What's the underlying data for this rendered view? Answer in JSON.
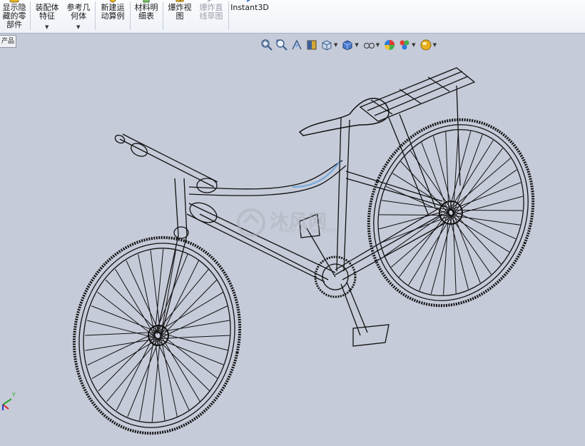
{
  "toolbar": {
    "show_hidden_label": "显示隐\n藏的零\n部件",
    "assembly_feature_label": "装配体\n特征",
    "reference_geometry_label": "参考几\n何体",
    "new_motion_study_label": "新建运\n动算例",
    "bom_label": "材料明\n细表",
    "exploded_view_label": "爆炸视\n图",
    "explode_line_sketch_label": "爆炸直\n线草图",
    "instant3d_label": "Instant3D"
  },
  "feature_tree_tab": {
    "label": "产品"
  },
  "heads_up_toolbar": {
    "items": [
      "zoom-to-fit-icon",
      "zoom-to-area-icon",
      "previous-view-icon",
      "section-view-icon",
      "view-orientation-icon",
      "display-style-icon",
      "hide-show-items-icon",
      "edit-appearance-icon",
      "apply-scene-icon",
      "view-settings-icon"
    ]
  },
  "watermark": {
    "text": "沐风网",
    "url": "www.mfcad.com"
  },
  "triad": {
    "y_label": "Y"
  },
  "colors": {
    "viewport_bg": "#c6cbd9",
    "wireframe": "#111111",
    "selection_highlight": "#6fa8dc"
  }
}
